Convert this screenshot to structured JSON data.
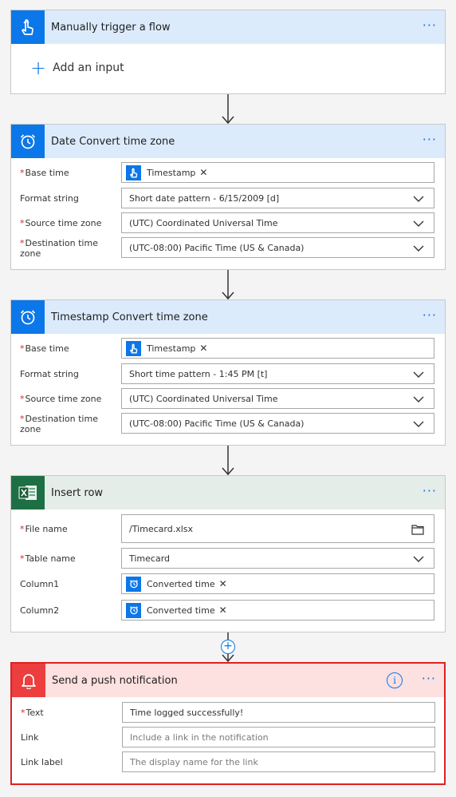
{
  "trigger": {
    "title": "Manually trigger a flow",
    "add_input": "Add an input"
  },
  "date_convert": {
    "title": "Date Convert time zone",
    "fields": [
      {
        "label": "Base time",
        "required": true,
        "token": "Timestamp"
      },
      {
        "label": "Format string",
        "required": false,
        "value": "Short date pattern - 6/15/2009 [d]"
      },
      {
        "label": "Source time zone",
        "required": true,
        "value": "(UTC) Coordinated Universal Time"
      },
      {
        "label": "Destination time zone",
        "label_line1": "Destination time",
        "label_line2": "zone",
        "required": true,
        "value": "(UTC-08:00) Pacific Time (US & Canada)"
      }
    ]
  },
  "timestamp_convert": {
    "title": "Timestamp Convert time zone",
    "fields": [
      {
        "label": "Base time",
        "required": true,
        "token": "Timestamp"
      },
      {
        "label": "Format string",
        "required": false,
        "value": "Short time pattern - 1:45 PM [t]"
      },
      {
        "label": "Source time zone",
        "required": true,
        "value": "(UTC) Coordinated Universal Time"
      },
      {
        "label": "Destination time zone",
        "label_line1": "Destination time",
        "label_line2": "zone",
        "required": true,
        "value": "(UTC-08:00) Pacific Time (US & Canada)"
      }
    ]
  },
  "insert_row": {
    "title": "Insert row",
    "fields": [
      {
        "label": "File name",
        "required": true,
        "value": "/Timecard.xlsx"
      },
      {
        "label": "Table name",
        "required": true,
        "value": "Timecard"
      },
      {
        "label": "Column1",
        "required": false,
        "token": "Converted time"
      },
      {
        "label": "Column2",
        "required": false,
        "token": "Converted time"
      }
    ]
  },
  "push": {
    "title": "Send a push notification",
    "fields": [
      {
        "label": "Text",
        "required": true,
        "value": "Time logged successfully!"
      },
      {
        "label": "Link",
        "required": false,
        "placeholder": "Include a link in the notification"
      },
      {
        "label": "Link label",
        "required": false,
        "placeholder": "The display name for the link"
      }
    ]
  },
  "more_label": "···",
  "info_label": "i",
  "icons": {
    "trigger": "touch-hand-icon",
    "time": "alarm-clock-icon",
    "excel": "excel-icon",
    "notification": "bell-icon"
  },
  "colors": {
    "blue_accent": "#0c77e8",
    "blue_header": "#dcebfc",
    "green_icon": "#1d7044",
    "green_header": "#e5ede9",
    "red_icon": "#ec3e3e",
    "red_header": "#fde0e0",
    "red_border": "#e02020"
  }
}
